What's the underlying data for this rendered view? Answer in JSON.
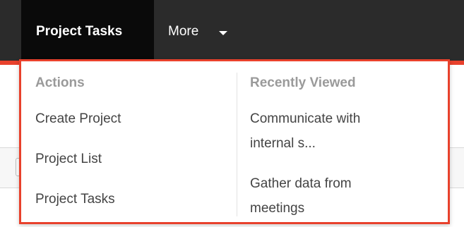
{
  "navbar": {
    "active_tab": "Project Tasks",
    "more_label": "More",
    "accent_color": "#e8412c",
    "background_color": "#2b2b2b"
  },
  "dropdown": {
    "border_color": "#e8412c",
    "actions": {
      "header": "Actions",
      "items": [
        "Create Project",
        "Project List",
        "Project Tasks"
      ]
    },
    "recently_viewed": {
      "header": "Recently Viewed",
      "items": [
        {
          "line1": "Communicate with",
          "line2": "internal s..."
        },
        {
          "line1": "Gather data from",
          "line2": "meetings"
        }
      ]
    }
  }
}
